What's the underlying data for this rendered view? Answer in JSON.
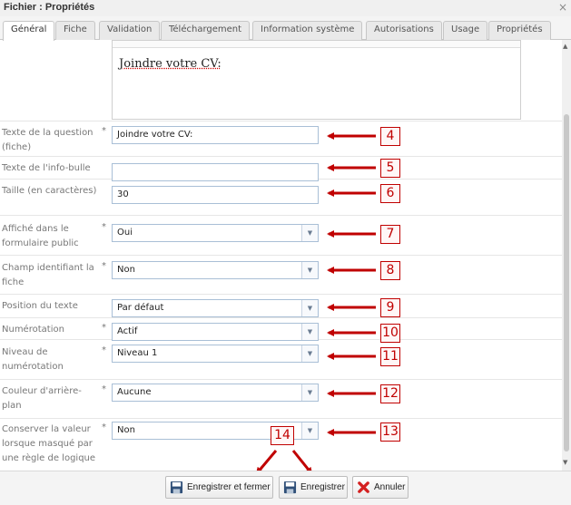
{
  "window": {
    "title": "Fichier : Propriétés",
    "close_glyph": "×"
  },
  "tabs": [
    {
      "label": "Général",
      "active": true
    },
    {
      "label": "Fiche"
    },
    {
      "label": "Validation"
    },
    {
      "label": "Téléchargement"
    },
    {
      "label": "Information système"
    },
    {
      "label": "Autorisations"
    },
    {
      "label": "Usage"
    },
    {
      "label": "Propriétés"
    }
  ],
  "editor": {
    "content": "Joindre votre CV:"
  },
  "fields": {
    "question_text": {
      "label": "Texte de la question (fiche)",
      "required": "*",
      "value": "Joindre votre CV:"
    },
    "tooltip_text": {
      "label": "Texte de l'info-bulle",
      "value": ""
    },
    "size": {
      "label": "Taille (en caractères)",
      "value": "30"
    },
    "shown_public": {
      "label": "Affiché dans le formulaire public",
      "required": "*",
      "value": "Oui"
    },
    "identifier": {
      "label": "Champ identifiant la fiche",
      "required": "*",
      "value": "Non"
    },
    "text_position": {
      "label": "Position du texte",
      "value": "Par défaut"
    },
    "numbering": {
      "label": "Numérotation",
      "required": "*",
      "value": "Actif"
    },
    "numbering_level": {
      "label": "Niveau de numérotation",
      "required": "*",
      "value": "Niveau 1"
    },
    "background_color": {
      "label": "Couleur d'arrière-plan",
      "required": "*",
      "value": "Aucune"
    },
    "keep_value": {
      "label": "Conserver la valeur lorsque masqué par une règle de logique",
      "required": "*",
      "value": "Non"
    }
  },
  "annotations": [
    "4",
    "5",
    "6",
    "7",
    "8",
    "9",
    "10",
    "11",
    "12",
    "13",
    "14"
  ],
  "buttons": {
    "save_close": "Enregistrer et fermer",
    "save": "Enregistrer",
    "cancel": "Annuler"
  },
  "icons": {
    "save": "floppy-disk-icon",
    "cancel": "red-x-icon",
    "select_caret": "chevron-down-icon"
  },
  "colors": {
    "annotation": "#c00000",
    "field_border": "#a9bfd6"
  }
}
